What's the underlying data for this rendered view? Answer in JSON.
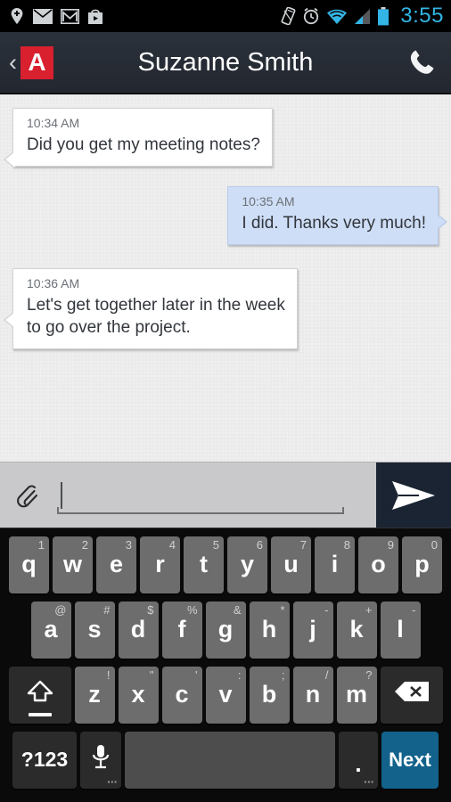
{
  "status_bar": {
    "time": "3:55",
    "accent_color": "#33b5e5",
    "left_icons": [
      {
        "name": "location-pin-icon",
        "label": "Location"
      },
      {
        "name": "email-envelope-icon",
        "label": "Email"
      },
      {
        "name": "gmail-icon",
        "label": "Gmail"
      },
      {
        "name": "play-store-icon",
        "label": "Play Store"
      }
    ],
    "right_icons": [
      {
        "name": "vibrate-icon",
        "label": "Vibrate"
      },
      {
        "name": "alarm-clock-icon",
        "label": "Alarm"
      },
      {
        "name": "wifi-icon",
        "label": "Wi-Fi"
      },
      {
        "name": "cell-signal-icon",
        "label": "Signal"
      },
      {
        "name": "battery-icon",
        "label": "Battery"
      }
    ]
  },
  "app_bar": {
    "back_label": "‹",
    "logo_letter": "A",
    "logo_color": "#d8202f",
    "title": "Suzanne Smith",
    "call_icon": "phone-icon",
    "background_color": "#262b33"
  },
  "conversation": {
    "background_color": "#ececed",
    "messages": [
      {
        "direction": "incoming",
        "time": "10:34 AM",
        "text": "Did you get my meeting notes?",
        "bubble_color": "#ffffff"
      },
      {
        "direction": "outgoing",
        "time": "10:35 AM",
        "text": "I did. Thanks very much!",
        "bubble_color": "#cedef6"
      },
      {
        "direction": "incoming",
        "time": "10:36 AM",
        "text": "Let's get together later in the week to go over the project.",
        "bubble_color": "#ffffff"
      }
    ]
  },
  "compose": {
    "attach_icon": "paperclip-icon",
    "input_value": "",
    "input_placeholder": "",
    "send_icon": "send-arrow-icon",
    "send_button_color": "#1b2433",
    "background_color": "#c9c9cb"
  },
  "keyboard": {
    "row1": [
      {
        "key": "q",
        "hint": "1"
      },
      {
        "key": "w",
        "hint": "2"
      },
      {
        "key": "e",
        "hint": "3"
      },
      {
        "key": "r",
        "hint": "4"
      },
      {
        "key": "t",
        "hint": "5"
      },
      {
        "key": "y",
        "hint": "6"
      },
      {
        "key": "u",
        "hint": "7"
      },
      {
        "key": "i",
        "hint": "8"
      },
      {
        "key": "o",
        "hint": "9"
      },
      {
        "key": "p",
        "hint": "0"
      }
    ],
    "row2": [
      {
        "key": "a",
        "hint": "@"
      },
      {
        "key": "s",
        "hint": "#"
      },
      {
        "key": "d",
        "hint": "$"
      },
      {
        "key": "f",
        "hint": "%"
      },
      {
        "key": "g",
        "hint": "&"
      },
      {
        "key": "h",
        "hint": "*"
      },
      {
        "key": "j",
        "hint": "-"
      },
      {
        "key": "k",
        "hint": "+"
      },
      {
        "key": "l",
        "hint": "-"
      }
    ],
    "row3": [
      {
        "key": "z",
        "hint": "!"
      },
      {
        "key": "x",
        "hint": "\""
      },
      {
        "key": "c",
        "hint": "'"
      },
      {
        "key": "v",
        "hint": ":"
      },
      {
        "key": "b",
        "hint": ";"
      },
      {
        "key": "n",
        "hint": "/"
      },
      {
        "key": "m",
        "hint": "?"
      }
    ],
    "shift_label": "shift-icon",
    "backspace_label": "backspace-icon",
    "symbols_label": "?123",
    "mic_label": "microphone-icon",
    "space_label": "",
    "period_label": ".",
    "next_label": "Next",
    "next_color": "#12628b"
  }
}
